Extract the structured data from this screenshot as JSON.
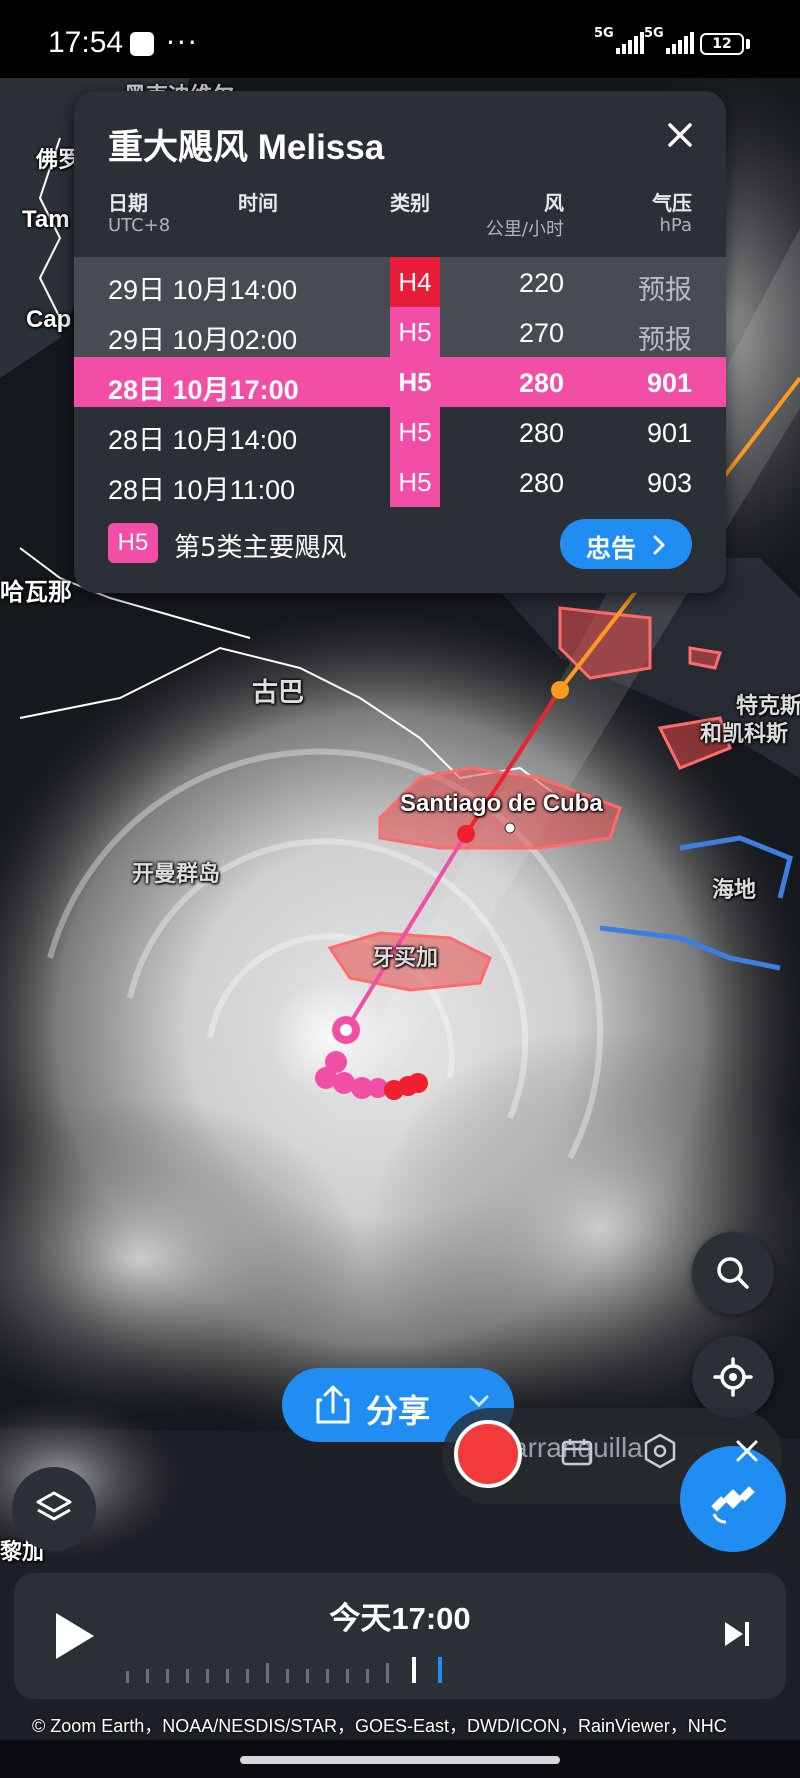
{
  "status_bar": {
    "time": "17:54",
    "more": "···",
    "signal_1": "5G",
    "signal_2": "5G",
    "battery": "12"
  },
  "map": {
    "labels": {
      "top_cut": "黑克迪维尔",
      "florida": "佛罗",
      "tampa": "Tam",
      "cape": "Cap",
      "havana": "哈瓦那",
      "cuba": "古巴",
      "turks": "特克斯",
      "caicos": "和凯科斯",
      "santiago": "Santiago de Cuba",
      "cayman": "开曼群岛",
      "haiti": "海地",
      "jamaica": "牙买加",
      "barranquilla": "arranquilla",
      "colombia_cut": "黎加"
    }
  },
  "storm": {
    "title": "重大飓风 Melissa",
    "headers": {
      "date": "日期",
      "date_sub": "UTC+8",
      "time": "时间",
      "category": "类别",
      "wind": "风",
      "wind_unit": "公里/小时",
      "pressure": "气压",
      "pressure_unit": "hPa"
    },
    "rows": [
      {
        "datetime": "29日 10月14:00",
        "category": "H4",
        "wind": "220",
        "pressure": "预报",
        "state": "forecast"
      },
      {
        "datetime": "29日 10月02:00",
        "category": "H5",
        "wind": "270",
        "pressure": "预报",
        "state": "forecast"
      },
      {
        "datetime": "28日 10月17:00",
        "category": "H5",
        "wind": "280",
        "pressure": "901",
        "state": "current"
      },
      {
        "datetime": "28日 10月14:00",
        "category": "H5",
        "wind": "280",
        "pressure": "901",
        "state": "past"
      },
      {
        "datetime": "28日 10月11:00",
        "category": "H5",
        "wind": "280",
        "pressure": "903",
        "state": "past"
      }
    ],
    "legend": {
      "badge": "H5",
      "text": "第5类主要飓风"
    },
    "advisory_label": "忠告"
  },
  "share": {
    "label": "分享"
  },
  "timeline": {
    "label": "今天17:00"
  },
  "credits": "© Zoom Earth，NOAA/NESDIS/STAR，GOES-East，DWD/ICON，RainViewer，NHC",
  "colors": {
    "accent": "#1f8df2",
    "cat5": "#f24ea5",
    "cat4": "#e81d3a",
    "panel": "#2b2f36",
    "record": "#f33a3a"
  }
}
